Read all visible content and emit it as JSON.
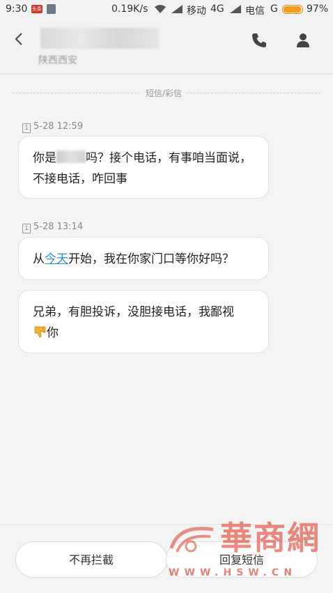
{
  "status_bar": {
    "time": "9:30",
    "app1_badge": "头条",
    "speed": "0.19K/s",
    "carrier1": "移动",
    "network1": "4G",
    "carrier2": "电信",
    "network2": "G",
    "battery_level": 0.97,
    "battery_percent": "97%",
    "colors": {
      "battery": "#f59a1c"
    }
  },
  "header": {
    "contact_name": "",
    "contact_subtitle": "陕西西安",
    "icons": [
      "back-icon",
      "phone-icon",
      "person-icon"
    ]
  },
  "thread": {
    "section_label": "短信/彩信",
    "groups": [
      {
        "timestamp": "5-28 12:59",
        "sim_icon": "1",
        "messages": [
          {
            "part1": "你是",
            "part2": "吗？接个电话，有事咱当面说，不接电话，咋回事"
          }
        ]
      },
      {
        "timestamp": "5-28 13:14",
        "sim_icon": "1",
        "messages": [
          {
            "part1": "从",
            "link": "今天",
            "part2": "开始，我在你家门口等你好吗？"
          },
          {
            "part1": "兄弟，有胆投诉，没胆接电话，我鄙视",
            "emoji": "thumbs-down-icon",
            "part2": "你"
          }
        ]
      }
    ]
  },
  "actions": {
    "unblock_label": "不再拦截",
    "reply_label": "回复短信"
  },
  "watermark": {
    "brand": "華商網",
    "url": "WWW.HSW.CN",
    "color": "#e04a3a"
  }
}
